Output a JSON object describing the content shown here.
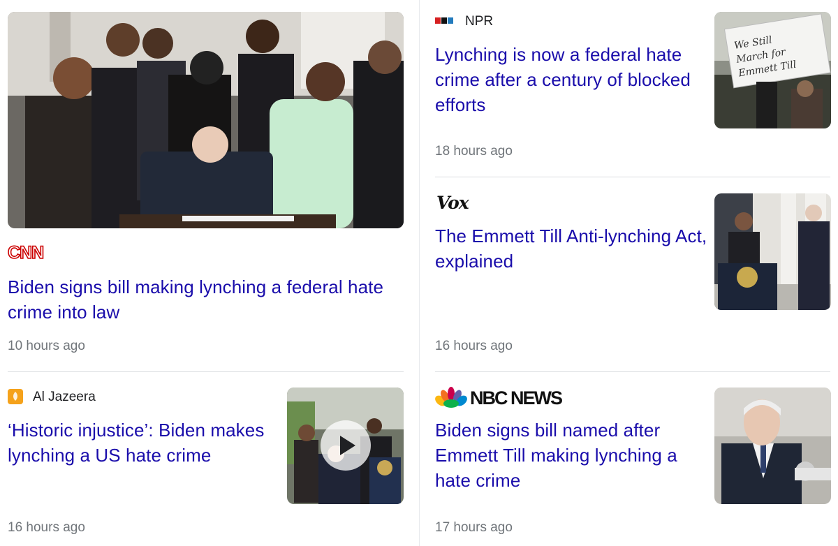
{
  "articles": [
    {
      "source": "CNN",
      "title": "Biden signs bill making lynching a federal hate crime into law",
      "time": "10 hours ago"
    },
    {
      "source": "Al Jazeera",
      "title": "‘Historic injustice’: Biden makes lynching a US hate crime",
      "time": "16 hours ago"
    },
    {
      "source": "NPR",
      "source_icon_text": "npr",
      "title": "Lynching is now a federal hate crime after a century of blocked efforts",
      "time": "18 hours ago",
      "thumb_sign_text": "We Still March for Emmett Till"
    },
    {
      "source": "Vox",
      "title": "The Emmett Till Anti-lynching Act, explained",
      "time": "16 hours ago"
    },
    {
      "source": "NBC NEWS",
      "title": "Biden signs bill named after Emmett Till making lynching a hate crime",
      "time": "17 hours ago"
    }
  ],
  "colors": {
    "link": "#1a0dab",
    "meta": "#70757a",
    "cnn_red": "#cc0000",
    "aljazeera_orange": "#f5a21b"
  },
  "icons": {
    "play": "play-icon",
    "nbc_peacock": "peacock-logo"
  }
}
